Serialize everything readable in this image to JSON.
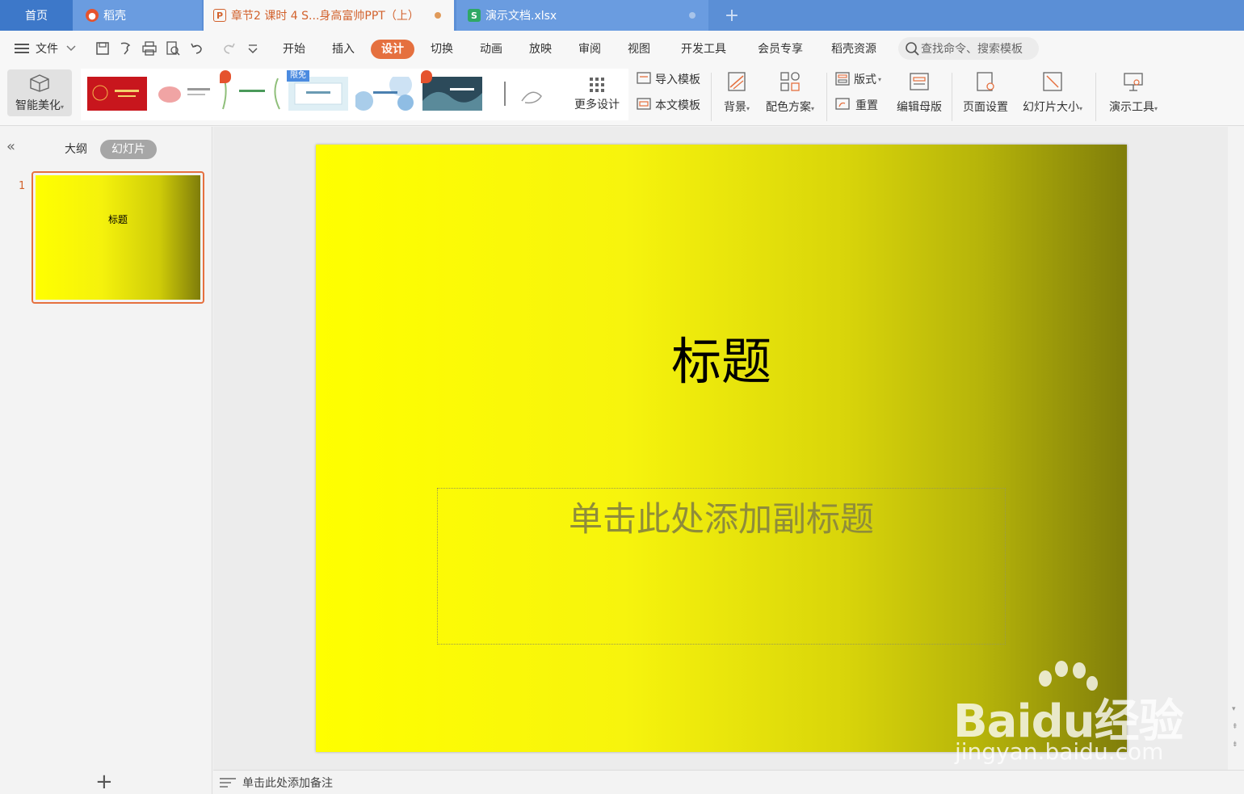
{
  "tabs": {
    "home": "首页",
    "daoke": "稻壳",
    "ppt": "章节2 课时 4 S...身高富帅PPT（上）",
    "xls": "演示文档.xlsx",
    "add": "+"
  },
  "menu": {
    "file": "文件",
    "items": [
      "开始",
      "插入",
      "设计",
      "切换",
      "动画",
      "放映",
      "审阅",
      "视图",
      "开发工具",
      "会员专享",
      "稻壳资源"
    ],
    "active": "设计",
    "search_placeholder": "查找命令、搜索模板"
  },
  "ribbon": {
    "smart_beautify": "智能美化",
    "free_badge": "限免",
    "more_design": "更多设计",
    "import_template": "导入模板",
    "this_template": "本文模板",
    "background": "背景",
    "color_scheme": "配色方案",
    "layout": "版式",
    "reset": "重置",
    "edit_master": "编辑母版",
    "page_setup": "页面设置",
    "slide_size": "幻灯片大小",
    "present_tools": "演示工具"
  },
  "left_panel": {
    "outline_tab": "大纲",
    "slides_tab": "幻灯片",
    "slide_number": "1",
    "thumb_title": "标题",
    "add": "+"
  },
  "slide": {
    "title": "标题",
    "subtitle_placeholder": "单击此处添加副标题"
  },
  "notes_placeholder": "单击此处添加备注",
  "watermark": {
    "main": "Baidu经验",
    "sub": "jingyan.baidu.com"
  },
  "colors": {
    "accent": "#e5703f",
    "tabbar": "#5b8fd6",
    "gradient_start": "#ffff00",
    "gradient_end": "#7f7d0a"
  }
}
